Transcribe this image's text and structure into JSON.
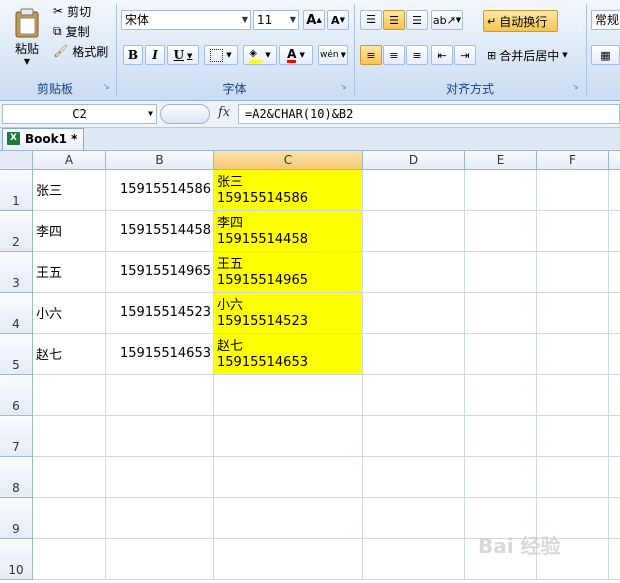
{
  "ribbon": {
    "clipboard": {
      "paste": "粘贴",
      "cut": "剪切",
      "copy": "复制",
      "format_painter": "格式刷",
      "group": "剪贴板"
    },
    "font": {
      "name": "宋体",
      "size": "11",
      "bold": "B",
      "italic": "I",
      "underline": "U",
      "font_color": "A",
      "phonetic": "wén",
      "grow": "A",
      "shrink": "A",
      "group": "字体"
    },
    "alignment": {
      "wrap_text": "自动换行",
      "merge_center": "合并后居中",
      "group": "对齐方式"
    },
    "number": {
      "format": "常规"
    }
  },
  "formula_bar": {
    "name_box": "C2",
    "fx": "fx",
    "formula": "=A2&CHAR(10)&B2"
  },
  "workbook": {
    "tab": "Book1 *",
    "icon_text": "X"
  },
  "sheet": {
    "columns": [
      "A",
      "B",
      "C",
      "D",
      "E",
      "F"
    ],
    "rows": [
      "1",
      "2",
      "3",
      "4",
      "5",
      "6",
      "7",
      "8",
      "9",
      "10"
    ],
    "data": [
      {
        "a": "张三",
        "b": "15915514586",
        "c1": "张三",
        "c2": "15915514586"
      },
      {
        "a": "李四",
        "b": "15915514458",
        "c1": "李四",
        "c2": "15915514458"
      },
      {
        "a": "王五",
        "b": "15915514965",
        "c1": "王五",
        "c2": "15915514965"
      },
      {
        "a": "小六",
        "b": "15915514523",
        "c1": "小六",
        "c2": "15915514523"
      },
      {
        "a": "赵七",
        "b": "15915514653",
        "c1": "赵七",
        "c2": "15915514653"
      }
    ],
    "highlight_color": "#ffff00"
  },
  "watermark": "Bai 经验"
}
